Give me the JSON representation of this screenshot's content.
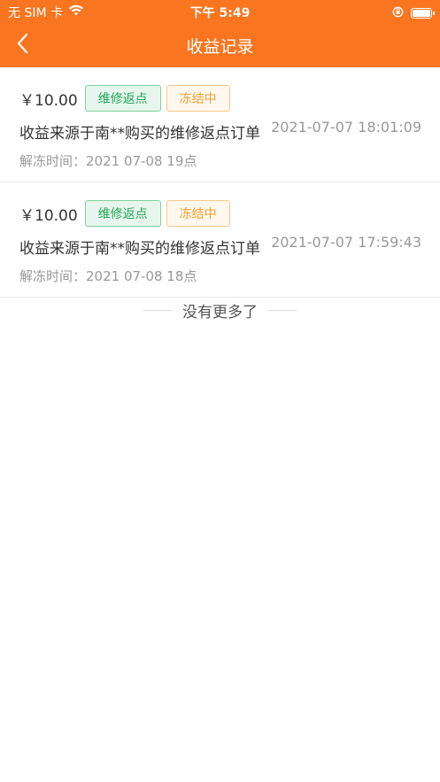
{
  "status_bar": {
    "carrier": "无 SIM 卡",
    "time": "下午 5:49",
    "icons": [
      "wifi-icon",
      "orientation-lock-icon",
      "battery-icon"
    ]
  },
  "nav": {
    "title": "收益记录",
    "back_icon": "chevron-left-icon"
  },
  "records": [
    {
      "amount": "￥10.00",
      "tag_type": "维修返点",
      "tag_status": "冻结中",
      "description": "收益来源于南**购买的维修返点订单",
      "time": "2021-07-07 18:01:09",
      "unfreeze": "解冻时间：2021 07-08 19点"
    },
    {
      "amount": "￥10.00",
      "tag_type": "维修返点",
      "tag_status": "冻结中",
      "description": "收益来源于南**购买的维修返点订单",
      "time": "2021-07-07 17:59:43",
      "unfreeze": "解冻时间：2021 07-08 18点"
    }
  ],
  "footer": {
    "no_more": "没有更多了"
  },
  "colors": {
    "header": "#f97520",
    "tag_green": "#26a65b",
    "tag_orange": "#f0a030"
  }
}
